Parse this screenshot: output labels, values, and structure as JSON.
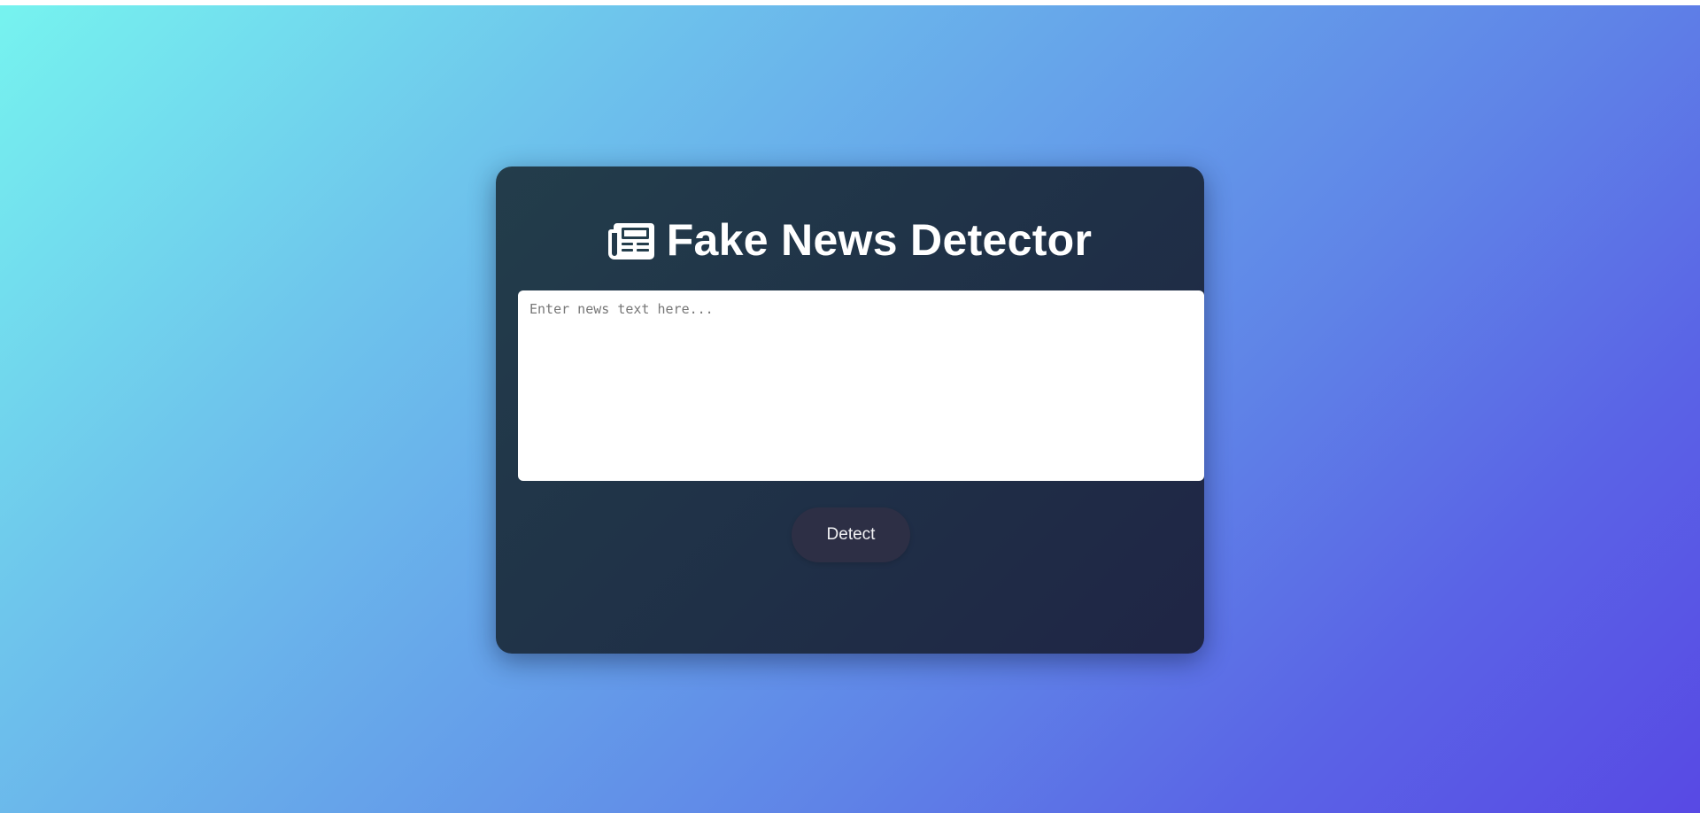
{
  "app": {
    "title": "Fake News Detector",
    "title_icon": "newspaper-icon"
  },
  "form": {
    "input_placeholder": "Enter news text here...",
    "input_value": "",
    "detect_label": "Detect"
  },
  "colors": {
    "background_gradient_start": "#76f3ef",
    "background_gradient_end": "#5849e4",
    "card_background": "#1f3047",
    "button_background": "#2d2f45",
    "title_color": "#ffffff"
  }
}
